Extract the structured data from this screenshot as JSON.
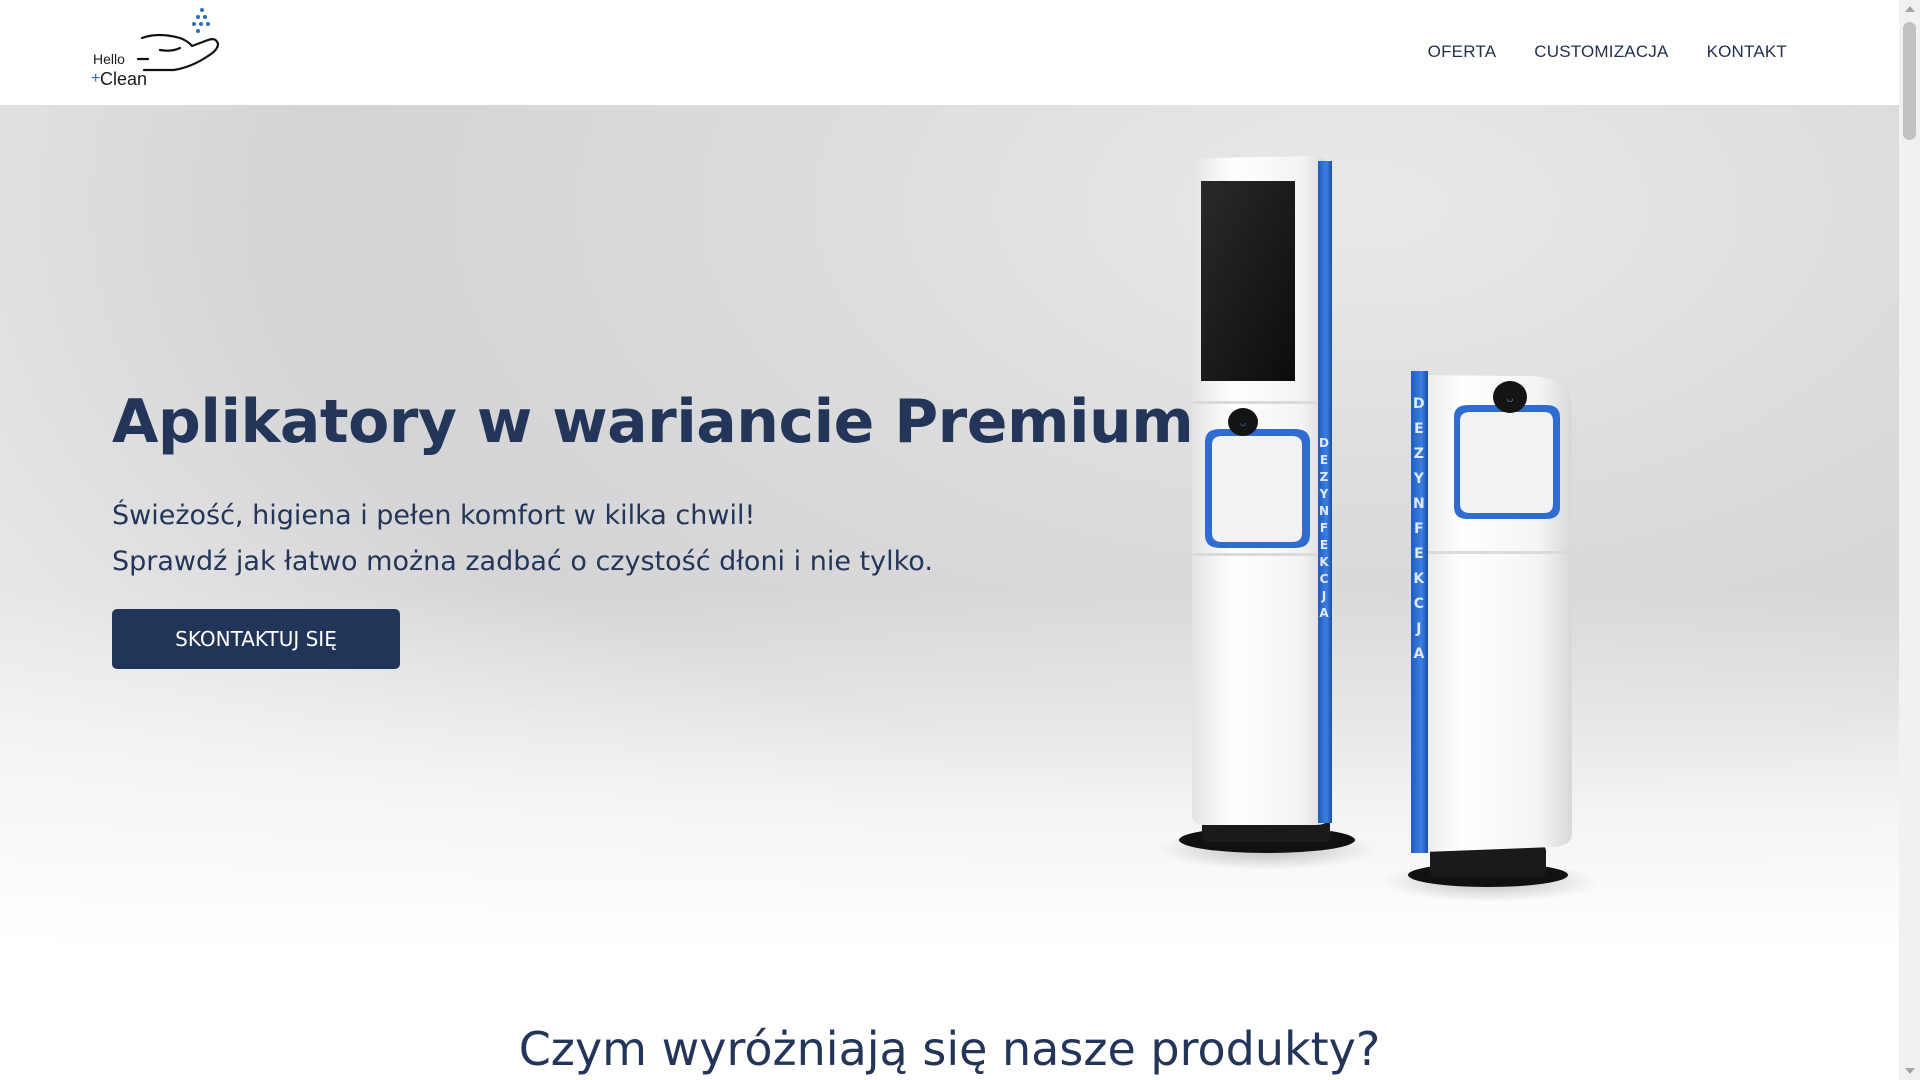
{
  "brand": {
    "line1": "Hello",
    "plus": "+",
    "line2": "Clean",
    "accent_color": "#2a6fb8"
  },
  "nav": {
    "items": [
      {
        "label": "OFERTA"
      },
      {
        "label": "CUSTOMIZACJA"
      },
      {
        "label": "KONTAKT"
      }
    ]
  },
  "hero": {
    "title": "Aplikatory w wariancie Premium",
    "subtitle_line1": "Świeżość, higiena i pełen komfort w kilka chwil!",
    "subtitle_line2": "Sprawdź jak łatwo można zadbać o czystość dłoni i nie tylko.",
    "cta_label": "SKONTAKTUJ SIĘ",
    "kiosk_stripe_text": "DEZYNFEKCJA"
  },
  "section": {
    "title": "Czym wyróżniają się nasze produkty?"
  },
  "colors": {
    "primary": "#213559",
    "text": "#23365a",
    "kiosk_blue": "#2d6ed2"
  }
}
